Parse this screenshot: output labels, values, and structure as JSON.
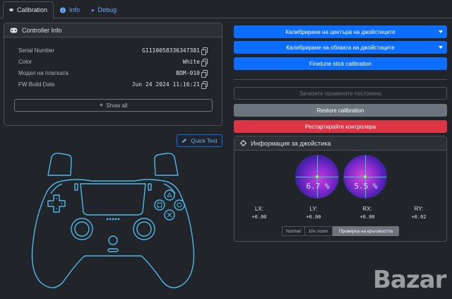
{
  "tabs": [
    {
      "label": "Calibration"
    },
    {
      "label": "Info"
    },
    {
      "label": "Debug"
    }
  ],
  "controller_info": {
    "title": "Controller Info",
    "rows": [
      {
        "label": "Serial Number",
        "value": "G1110058336347381"
      },
      {
        "label": "Color",
        "value": "White"
      },
      {
        "label": "Модел на платката",
        "value": "BDM-010"
      },
      {
        "label": "FW Build Date",
        "value": "Jun 24 2024 11:16:21"
      }
    ],
    "show_all": "Show all"
  },
  "quick_test": "Quick Test",
  "actions": {
    "calibrate_center": "Калибриране на центъра на джойстиците",
    "calibrate_range": "Калибриране на обхвата на джойстиците",
    "finetune": "Finetune stick calibration",
    "save_permanent": "Запазете промените постоянно",
    "restore": "Restore calibration",
    "restart": "Рестартирайте контролера"
  },
  "stick_info": {
    "title": "Информация за джойстика",
    "left_pct": "6.7 %",
    "right_pct": "5.5 %",
    "axes": [
      {
        "label": "LX:",
        "value": "+0.00"
      },
      {
        "label": "LY:",
        "value": "+0.00"
      },
      {
        "label": "RX:",
        "value": "+0.00"
      },
      {
        "label": "RY:",
        "value": "+0.02"
      }
    ],
    "modes": [
      "Normal",
      "10x zoom",
      "Проверка на кръговостта"
    ],
    "active_mode": "Проверка на кръговостта"
  },
  "watermark": "Bazar",
  "colors": {
    "accent": "#0d6efd",
    "danger": "#dc3545",
    "secondary": "#6c757d",
    "controller_outline": "#4fb8e8"
  },
  "icons": {
    "tab_calibration": "gamepad-icon",
    "tab_info": "info-icon",
    "tab_debug": "bug-icon",
    "quick_test": "pencil-icon",
    "stick_info": "crosshair-icon"
  }
}
